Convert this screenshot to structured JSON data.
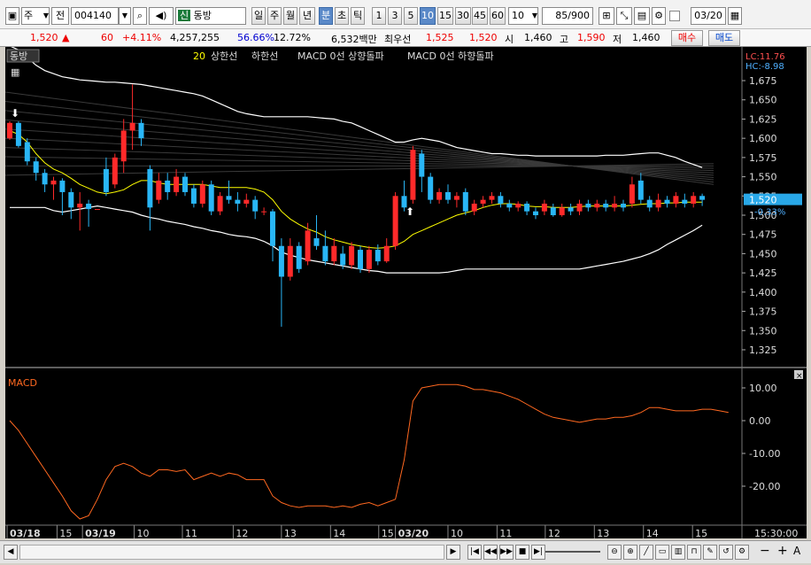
{
  "toolbar": {
    "type_label": "주",
    "period_select": "전",
    "code": "004140",
    "badge": "신",
    "name": "동방",
    "periods": [
      "일",
      "주",
      "월",
      "년",
      "분",
      "초",
      "틱"
    ],
    "intervals": [
      "1",
      "3",
      "5",
      "10",
      "15",
      "30",
      "45",
      "60"
    ],
    "count": "10",
    "page": "85/900",
    "date": "03/20"
  },
  "quote": {
    "price": "1,520",
    "change_arrow": "▲",
    "change": "60",
    "change_rate": "+4.11%",
    "volume": "4,257,255",
    "vol_ratio": "56.66%",
    "turnover": "12.72%",
    "amount": "6,532백만",
    "best_ask_label": "최우선",
    "best_ask": "1,525",
    "best_bid": "1,520",
    "open_label": "시",
    "open": "1,460",
    "high_label": "고",
    "high": "1,590",
    "low_label": "저",
    "low": "1,460",
    "buy": "매수",
    "sell": "매도"
  },
  "legend": {
    "name": "동방",
    "ma_num": "20",
    "upper": "상한선",
    "lower": "하한선",
    "macd_up": "MACD 0선 상향돌파",
    "macd_down": "MACD 0선 하향돌파"
  },
  "price_axis": {
    "lc": "LC:11.76",
    "hc": "HC:-8.98",
    "ticks": [
      "1,675",
      "1,650",
      "1,625",
      "1,600",
      "1,575",
      "1,550",
      "1,525",
      "1,500",
      "1,475",
      "1,450",
      "1,425",
      "1,400",
      "1,375",
      "1,350",
      "1,325"
    ],
    "current": "1,520",
    "current_pct": "-0.33%"
  },
  "macd": {
    "label": "MACD",
    "ticks": [
      "10.00",
      "0.00",
      "-10.00",
      "-20.00"
    ]
  },
  "time_axis": {
    "labels": [
      "03/18",
      "15",
      "03/19",
      "10",
      "11",
      "12",
      "13",
      "14",
      "15",
      "03/20",
      "10",
      "11",
      "12",
      "13",
      "14",
      "15"
    ],
    "time": "15:30:00"
  },
  "colors": {
    "up": "#ff2a2a",
    "down": "#29b6f6",
    "macd": "#ff6820",
    "ma": "#ffff00",
    "band": "#ffffff"
  },
  "chart_data": {
    "type": "candlestick",
    "candles": [
      {
        "o": 1600,
        "c": 1620,
        "h": 1622,
        "l": 1598
      },
      {
        "o": 1620,
        "c": 1590,
        "h": 1622,
        "l": 1588
      },
      {
        "o": 1595,
        "c": 1570,
        "h": 1600,
        "l": 1565
      },
      {
        "o": 1570,
        "c": 1555,
        "h": 1575,
        "l": 1545
      },
      {
        "o": 1555,
        "c": 1540,
        "h": 1560,
        "l": 1530
      },
      {
        "o": 1540,
        "c": 1545,
        "h": 1550,
        "l": 1520
      },
      {
        "o": 1545,
        "c": 1530,
        "h": 1548,
        "l": 1500
      },
      {
        "o": 1530,
        "c": 1510,
        "h": 1535,
        "l": 1495
      },
      {
        "o": 1510,
        "c": 1515,
        "h": 1530,
        "l": 1480
      },
      {
        "o": 1515,
        "c": 1508,
        "h": 1520,
        "l": 1485
      },
      {
        "o": 1508,
        "c": 1508,
        "h": 1508,
        "l": 1508
      },
      {
        "o": 1560,
        "c": 1530,
        "h": 1575,
        "l": 1525
      },
      {
        "o": 1540,
        "c": 1575,
        "h": 1580,
        "l": 1535
      },
      {
        "o": 1570,
        "c": 1610,
        "h": 1625,
        "l": 1555
      },
      {
        "o": 1610,
        "c": 1620,
        "h": 1670,
        "l": 1585
      },
      {
        "o": 1620,
        "c": 1600,
        "h": 1625,
        "l": 1590
      },
      {
        "o": 1560,
        "c": 1510,
        "h": 1565,
        "l": 1480
      },
      {
        "o": 1520,
        "c": 1545,
        "h": 1555,
        "l": 1515
      },
      {
        "o": 1545,
        "c": 1530,
        "h": 1555,
        "l": 1520
      },
      {
        "o": 1530,
        "c": 1550,
        "h": 1560,
        "l": 1525
      },
      {
        "o": 1550,
        "c": 1530,
        "h": 1555,
        "l": 1525
      },
      {
        "o": 1535,
        "c": 1515,
        "h": 1540,
        "l": 1510
      },
      {
        "o": 1515,
        "c": 1540,
        "h": 1545,
        "l": 1510
      },
      {
        "o": 1540,
        "c": 1505,
        "h": 1545,
        "l": 1500
      },
      {
        "o": 1505,
        "c": 1525,
        "h": 1530,
        "l": 1500
      },
      {
        "o": 1525,
        "c": 1520,
        "h": 1545,
        "l": 1515
      },
      {
        "o": 1520,
        "c": 1515,
        "h": 1530,
        "l": 1505
      },
      {
        "o": 1515,
        "c": 1520,
        "h": 1528,
        "l": 1510
      },
      {
        "o": 1520,
        "c": 1505,
        "h": 1525,
        "l": 1495
      },
      {
        "o": 1505,
        "c": 1505,
        "h": 1510,
        "l": 1500
      },
      {
        "o": 1505,
        "c": 1460,
        "h": 1508,
        "l": 1440
      },
      {
        "o": 1460,
        "c": 1420,
        "h": 1470,
        "l": 1355
      },
      {
        "o": 1420,
        "c": 1460,
        "h": 1470,
        "l": 1415
      },
      {
        "o": 1460,
        "c": 1430,
        "h": 1465,
        "l": 1425
      },
      {
        "o": 1440,
        "c": 1480,
        "h": 1490,
        "l": 1435
      },
      {
        "o": 1470,
        "c": 1460,
        "h": 1500,
        "l": 1455
      },
      {
        "o": 1460,
        "c": 1440,
        "h": 1480,
        "l": 1435
      },
      {
        "o": 1440,
        "c": 1460,
        "h": 1470,
        "l": 1435
      },
      {
        "o": 1450,
        "c": 1435,
        "h": 1460,
        "l": 1430
      },
      {
        "o": 1435,
        "c": 1460,
        "h": 1465,
        "l": 1430
      },
      {
        "o": 1455,
        "c": 1430,
        "h": 1460,
        "l": 1425
      },
      {
        "o": 1430,
        "c": 1455,
        "h": 1460,
        "l": 1425
      },
      {
        "o": 1455,
        "c": 1440,
        "h": 1462,
        "l": 1435
      },
      {
        "o": 1440,
        "c": 1460,
        "h": 1470,
        "l": 1438
      },
      {
        "o": 1460,
        "c": 1525,
        "h": 1530,
        "l": 1455
      },
      {
        "o": 1525,
        "c": 1510,
        "h": 1545,
        "l": 1505
      },
      {
        "o": 1520,
        "c": 1585,
        "h": 1590,
        "l": 1515
      },
      {
        "o": 1580,
        "c": 1550,
        "h": 1585,
        "l": 1530
      },
      {
        "o": 1550,
        "c": 1520,
        "h": 1555,
        "l": 1515
      },
      {
        "o": 1520,
        "c": 1530,
        "h": 1535,
        "l": 1515
      },
      {
        "o": 1530,
        "c": 1520,
        "h": 1540,
        "l": 1515
      },
      {
        "o": 1520,
        "c": 1525,
        "h": 1530,
        "l": 1510
      },
      {
        "o": 1530,
        "c": 1505,
        "h": 1535,
        "l": 1500
      },
      {
        "o": 1505,
        "c": 1515,
        "h": 1520,
        "l": 1500
      },
      {
        "o": 1515,
        "c": 1520,
        "h": 1525,
        "l": 1510
      },
      {
        "o": 1520,
        "c": 1525,
        "h": 1530,
        "l": 1515
      },
      {
        "o": 1525,
        "c": 1515,
        "h": 1530,
        "l": 1510
      },
      {
        "o": 1515,
        "c": 1510,
        "h": 1520,
        "l": 1505
      },
      {
        "o": 1510,
        "c": 1515,
        "h": 1518,
        "l": 1505
      },
      {
        "o": 1515,
        "c": 1505,
        "h": 1518,
        "l": 1500
      },
      {
        "o": 1505,
        "c": 1500,
        "h": 1510,
        "l": 1495
      },
      {
        "o": 1505,
        "c": 1515,
        "h": 1520,
        "l": 1500
      },
      {
        "o": 1510,
        "c": 1500,
        "h": 1515,
        "l": 1498
      },
      {
        "o": 1500,
        "c": 1510,
        "h": 1515,
        "l": 1498
      },
      {
        "o": 1510,
        "c": 1505,
        "h": 1515,
        "l": 1500
      },
      {
        "o": 1505,
        "c": 1515,
        "h": 1520,
        "l": 1500
      },
      {
        "o": 1515,
        "c": 1510,
        "h": 1520,
        "l": 1505
      },
      {
        "o": 1510,
        "c": 1515,
        "h": 1520,
        "l": 1505
      },
      {
        "o": 1515,
        "c": 1510,
        "h": 1520,
        "l": 1505
      },
      {
        "o": 1510,
        "c": 1515,
        "h": 1525,
        "l": 1505
      },
      {
        "o": 1515,
        "c": 1510,
        "h": 1520,
        "l": 1505
      },
      {
        "o": 1515,
        "c": 1540,
        "h": 1550,
        "l": 1510
      },
      {
        "o": 1545,
        "c": 1520,
        "h": 1555,
        "l": 1515
      },
      {
        "o": 1520,
        "c": 1510,
        "h": 1525,
        "l": 1505
      },
      {
        "o": 1510,
        "c": 1520,
        "h": 1528,
        "l": 1505
      },
      {
        "o": 1520,
        "c": 1515,
        "h": 1525,
        "l": 1510
      },
      {
        "o": 1515,
        "c": 1525,
        "h": 1530,
        "l": 1510
      },
      {
        "o": 1520,
        "c": 1515,
        "h": 1528,
        "l": 1510
      },
      {
        "o": 1515,
        "c": 1525,
        "h": 1530,
        "l": 1510
      },
      {
        "o": 1525,
        "c": 1520,
        "h": 1528,
        "l": 1512
      }
    ],
    "ma20": [
      1610,
      1605,
      1595,
      1580,
      1568,
      1560,
      1555,
      1548,
      1540,
      1535,
      1530,
      1528,
      1530,
      1533,
      1540,
      1545,
      1545,
      1542,
      1540,
      1540,
      1540,
      1540,
      1540,
      1538,
      1536,
      1536,
      1536,
      1536,
      1534,
      1530,
      1520,
      1505,
      1495,
      1488,
      1482,
      1478,
      1472,
      1468,
      1465,
      1462,
      1460,
      1458,
      1457,
      1458,
      1460,
      1466,
      1475,
      1480,
      1485,
      1490,
      1495,
      1500,
      1503,
      1506,
      1510,
      1513,
      1515,
      1515,
      1514,
      1512,
      1511,
      1511,
      1510,
      1510,
      1510,
      1511,
      1512,
      1512,
      1512,
      1512,
      1512,
      1513,
      1514,
      1515,
      1515,
      1516,
      1516,
      1517,
      1517,
      1517
    ],
    "upper": [
      1720,
      1715,
      1705,
      1695,
      1688,
      1684,
      1680,
      1678,
      1676,
      1675,
      1674,
      1673,
      1673,
      1672,
      1671,
      1670,
      1668,
      1666,
      1664,
      1662,
      1660,
      1658,
      1655,
      1650,
      1645,
      1640,
      1635,
      1632,
      1630,
      1628,
      1628,
      1628,
      1628,
      1628,
      1628,
      1627,
      1626,
      1625,
      1622,
      1620,
      1615,
      1610,
      1605,
      1600,
      1595,
      1595,
      1598,
      1600,
      1598,
      1596,
      1592,
      1588,
      1586,
      1584,
      1582,
      1580,
      1580,
      1579,
      1578,
      1578,
      1577,
      1577,
      1577,
      1577,
      1577,
      1577,
      1577,
      1577,
      1578,
      1578,
      1578,
      1579,
      1580,
      1581,
      1581,
      1578,
      1575,
      1570,
      1566,
      1562
    ],
    "lower": [
      1510,
      1510,
      1510,
      1510,
      1510,
      1506,
      1504,
      1506,
      1508,
      1510,
      1512,
      1510,
      1508,
      1506,
      1504,
      1500,
      1497,
      1495,
      1492,
      1490,
      1488,
      1485,
      1483,
      1480,
      1478,
      1475,
      1473,
      1472,
      1470,
      1466,
      1460,
      1452,
      1448,
      1445,
      1442,
      1440,
      1438,
      1436,
      1434,
      1432,
      1430,
      1428,
      1427,
      1425,
      1425,
      1425,
      1425,
      1425,
      1425,
      1425,
      1426,
      1428,
      1430,
      1430,
      1430,
      1430,
      1430,
      1430,
      1430,
      1430,
      1430,
      1430,
      1430,
      1430,
      1430,
      1430,
      1432,
      1434,
      1436,
      1438,
      1440,
      1443,
      1446,
      1450,
      1455,
      1462,
      1468,
      1474,
      1480,
      1487
    ],
    "macd": [
      0,
      -3,
      -7,
      -11,
      -15,
      -19,
      -23,
      -27.5,
      -30,
      -29,
      -24,
      -18,
      -14,
      -13,
      -14,
      -16,
      -17,
      -15,
      -15,
      -15.5,
      -15,
      -18,
      -17,
      -16,
      -17,
      -16,
      -16.5,
      -18,
      -18,
      -18,
      -23,
      -25,
      -26,
      -26.5,
      -26,
      -26,
      -26,
      -26.5,
      -26,
      -26.5,
      -25.5,
      -25,
      -26,
      -25,
      -24,
      -12,
      6,
      10,
      10.5,
      11,
      11,
      11,
      10.5,
      9.5,
      9.5,
      9,
      8.5,
      7.5,
      6.5,
      5,
      3.5,
      2,
      1,
      0.5,
      0,
      -0.5,
      0,
      0.5,
      0.5,
      1,
      1,
      1.5,
      2.5,
      4,
      4,
      3.5,
      3,
      3,
      3,
      3.5,
      3.5,
      3,
      2.5
    ]
  }
}
